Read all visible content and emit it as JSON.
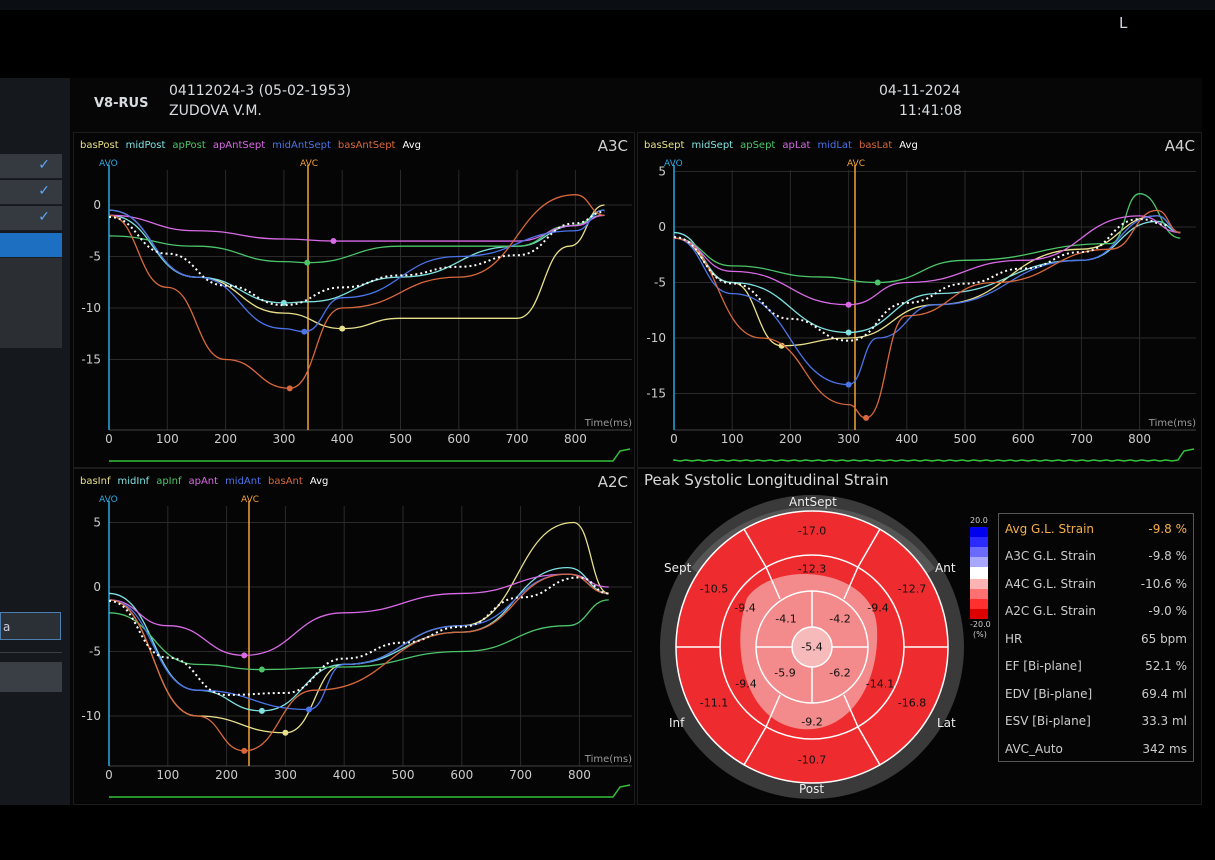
{
  "header": {
    "site": "V8-RUS",
    "patient_id": "04112024-3 (05-02-1953)",
    "patient_name": "ZUDOVA V.M.",
    "date": "04-11-2024",
    "time": "11:41:08",
    "corner_mark": "L"
  },
  "sidebar": {
    "input_value": "a",
    "check_icon": "✓"
  },
  "colors": {
    "avo": "#2aa8e0",
    "avc": "#f2a33a",
    "ecg": "#35c23a",
    "bas1": "#e8e08a",
    "mid1": "#7fe0e0",
    "ap1": "#4cc46a",
    "ap2": "#d86ae6",
    "mid2": "#4a74e8",
    "bas2": "#d8683c",
    "avg": "#ffffff"
  },
  "plots": [
    {
      "view": "A3C",
      "legend": [
        {
          "name": "basPost",
          "color": "#e8e08a"
        },
        {
          "name": "midPost",
          "color": "#7fe0e0"
        },
        {
          "name": "apPost",
          "color": "#4cc46a"
        },
        {
          "name": "apAntSept",
          "color": "#d86ae6"
        },
        {
          "name": "midAntSept",
          "color": "#4a74e8"
        },
        {
          "name": "basAntSept",
          "color": "#d8683c"
        },
        {
          "name": "Avg",
          "color": "#ffffff"
        }
      ],
      "avo_label": "AVO",
      "avc_label": "AVC",
      "xunit": "Time(ms)",
      "xticks": [
        "0",
        "100",
        "200",
        "300",
        "400",
        "500",
        "600",
        "700",
        "800"
      ],
      "yticks": [
        "0",
        "-5",
        "-10",
        "-15"
      ]
    },
    {
      "view": "A4C",
      "legend": [
        {
          "name": "basSept",
          "color": "#e8e08a"
        },
        {
          "name": "midSept",
          "color": "#7fe0e0"
        },
        {
          "name": "apSept",
          "color": "#4cc46a"
        },
        {
          "name": "apLat",
          "color": "#d86ae6"
        },
        {
          "name": "midLat",
          "color": "#4a74e8"
        },
        {
          "name": "basLat",
          "color": "#d8683c"
        },
        {
          "name": "Avg",
          "color": "#ffffff"
        }
      ],
      "avo_label": "AVO",
      "avc_label": "AVC",
      "xunit": "Time(ms)",
      "xticks": [
        "0",
        "100",
        "200",
        "300",
        "400",
        "500",
        "600",
        "700",
        "800"
      ],
      "yticks": [
        "5",
        "0",
        "-5",
        "-10",
        "-15"
      ]
    },
    {
      "view": "A2C",
      "legend": [
        {
          "name": "basInf",
          "color": "#e8e08a"
        },
        {
          "name": "midInf",
          "color": "#7fe0e0"
        },
        {
          "name": "apInf",
          "color": "#4cc46a"
        },
        {
          "name": "apAnt",
          "color": "#d86ae6"
        },
        {
          "name": "midAnt",
          "color": "#4a74e8"
        },
        {
          "name": "basAnt",
          "color": "#d8683c"
        },
        {
          "name": "Avg",
          "color": "#ffffff"
        }
      ],
      "avo_label": "AVO",
      "avc_label": "AVC",
      "xunit": "Time(ms)",
      "xticks": [
        "0",
        "100",
        "200",
        "300",
        "400",
        "500",
        "600",
        "700",
        "800"
      ],
      "yticks": [
        "5",
        "0",
        "-5",
        "-10"
      ]
    }
  ],
  "bullseye": {
    "title": "Peak Systolic Longitudinal Strain",
    "labels": {
      "antsept": "AntSept",
      "ant": "Ant",
      "lat": "Lat",
      "post": "Post",
      "inf": "Inf",
      "sept": "Sept"
    },
    "basal": [
      "-17.0",
      "-12.7",
      "-16.8",
      "-10.7",
      "-11.1",
      "-10.5"
    ],
    "mid": [
      "-12.3",
      "-9.4",
      "-14.1",
      "-9.2",
      "-9.4",
      "-9.4"
    ],
    "apical": [
      "-4.2",
      "-6.2",
      "-5.9",
      "-4.1"
    ],
    "apex": "-5.4",
    "scale_top": "20.0",
    "scale_bottom": "-20.0",
    "scale_unit": "(%)"
  },
  "summary": [
    {
      "label": "Avg G.L. Strain",
      "value": "-9.8 %"
    },
    {
      "label": "A3C G.L. Strain",
      "value": "-9.8 %"
    },
    {
      "label": "A4C G.L. Strain",
      "value": "-10.6 %"
    },
    {
      "label": "A2C G.L. Strain",
      "value": "-9.0 %"
    },
    {
      "label": "HR",
      "value": "65 bpm"
    },
    {
      "label": "EF [Bi-plane]",
      "value": "52.1 %"
    },
    {
      "label": "EDV [Bi-plane]",
      "value": "69.4 ml"
    },
    {
      "label": "ESV [Bi-plane]",
      "value": "33.3 ml"
    },
    {
      "label": "AVC_Auto",
      "value": "342 ms"
    }
  ]
}
